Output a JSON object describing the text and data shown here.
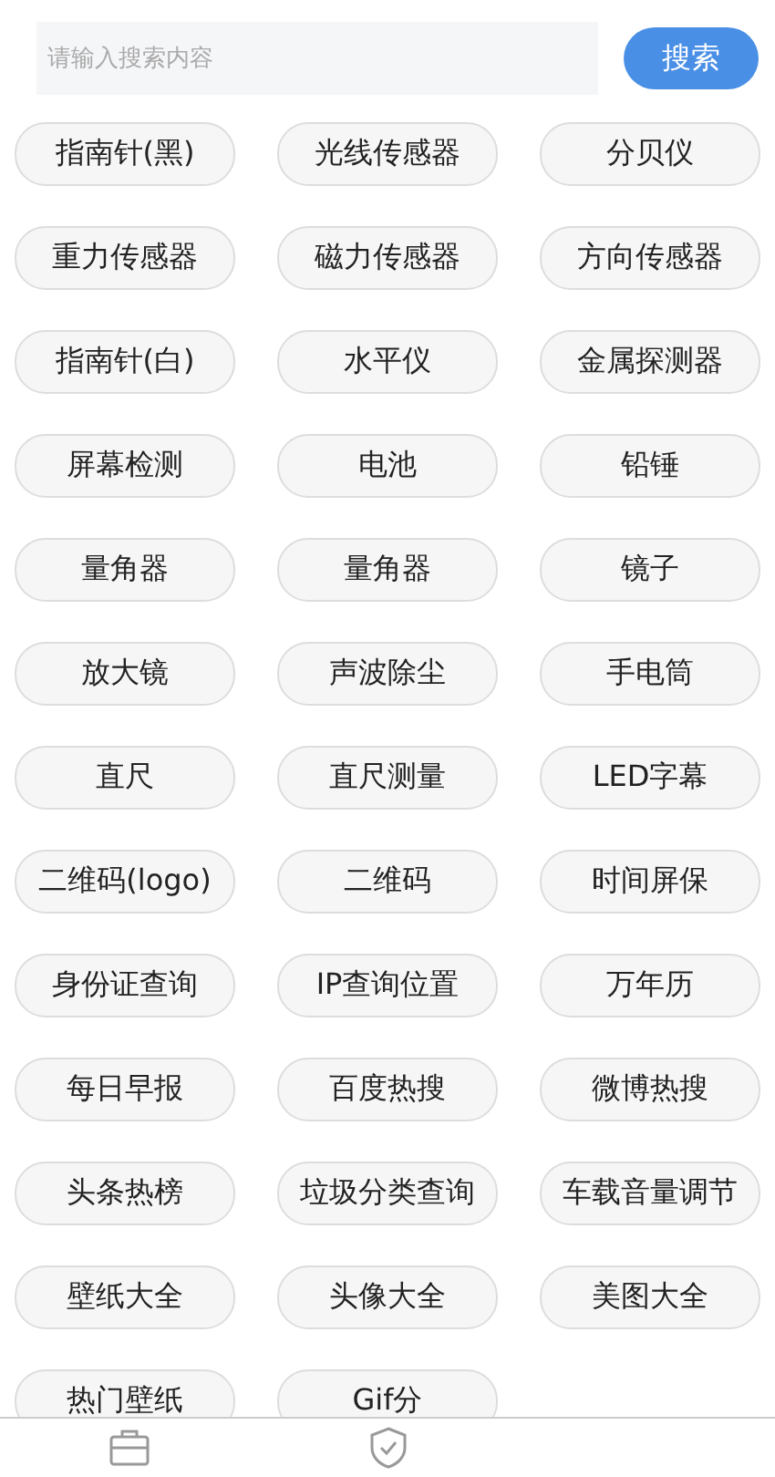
{
  "search": {
    "placeholder": "请输入搜索内容",
    "button": "搜索"
  },
  "tools": [
    "指南针(黑)",
    "光线传感器",
    "分贝仪",
    "重力传感器",
    "磁力传感器",
    "方向传感器",
    "指南针(白)",
    "水平仪",
    "金属探测器",
    "屏幕检测",
    "电池",
    "铅锤",
    "量角器",
    "量角器",
    "镜子",
    "放大镜",
    "声波除尘",
    "手电筒",
    "直尺",
    "直尺测量",
    "LED字幕",
    "二维码(logo)",
    "二维码",
    "时间屏保",
    "身份证查询",
    "IP查询位置",
    "万年历",
    "每日早报",
    "百度热搜",
    "微博热搜",
    "头条热榜",
    "垃圾分类查询",
    "车载音量调节",
    "壁纸大全",
    "头像大全",
    "美图大全",
    "热门壁纸",
    "Gif分"
  ],
  "tab_bar": [
    {
      "kind": "briefcase"
    },
    {
      "kind": "shield"
    }
  ]
}
